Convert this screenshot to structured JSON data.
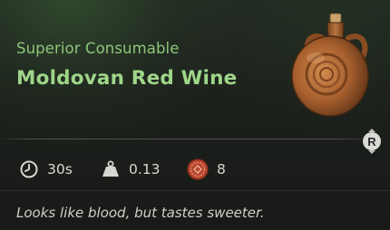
{
  "item": {
    "rarity": "Superior Consumable",
    "name": "Moldovan Red Wine",
    "image_icon": "wine-flask-icon",
    "description": "Looks like blood, but tastes sweeter."
  },
  "controls": {
    "inspect_key": "R"
  },
  "stats": {
    "duration": {
      "icon": "clock-icon",
      "value": "30s"
    },
    "weight": {
      "icon": "weight-icon",
      "value": "0.13"
    },
    "value": {
      "icon": "coin-icon",
      "value": "8"
    }
  },
  "colors": {
    "rarity_green": "#8fc67a",
    "name_green": "#9fd589",
    "text_light": "#d8d8d4",
    "coin_red": "#b8452d"
  }
}
